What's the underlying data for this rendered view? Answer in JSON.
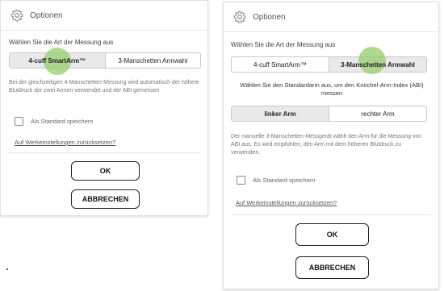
{
  "left_dialog": {
    "title": "Optionen",
    "prompt": "Wählen Sie die Art der Messung aus",
    "options": [
      "4-cuff SmartArm™",
      "3-Manschetten Armwahl"
    ],
    "selected_index": 0,
    "description": "Bei der gleichzeitigen 4-Manschetten-Messung wird automatisch der höhere Blutdruck der zwei Armen verwendet und der ABI gemessen",
    "checkbox_label": "Als Standard speichern",
    "checkbox_checked": false,
    "reset_link": "Auf Werkeinstellungen zurücksetzen?",
    "ok_label": "OK",
    "cancel_label": "ABBRECHEN"
  },
  "right_dialog": {
    "title": "Optionen",
    "prompt": "Wählen Sie die Art der Messung aus",
    "options": [
      "4-cuff SmartArm™",
      "3-Manschetten Armwahl"
    ],
    "selected_index": 1,
    "arm_prompt": "Wählen Sie den Standardarm aus, um den Knöchel-Arm-Index (ABI) messen",
    "arm_options": [
      "linker Arm",
      "rechter Arm"
    ],
    "arm_selected_index": 0,
    "description": "Der manuelle 3-Manschetten-Messgerät wählt den Arm für die Messung von ABI aus. Es wird empfohlen, den Arm mit dem höheren Blutdruck zu verwenden.",
    "checkbox_label": "Als Standard speichern",
    "checkbox_checked": false,
    "reset_link": "Auf Werkeinstellungen zurücksetzen?",
    "ok_label": "OK",
    "cancel_label": "ABBRECHEN"
  },
  "icons": {
    "settings": "gear-icon"
  },
  "colors": {
    "touch_indicator": "#96cd6e",
    "selected_segment": "#e9e9e9"
  }
}
